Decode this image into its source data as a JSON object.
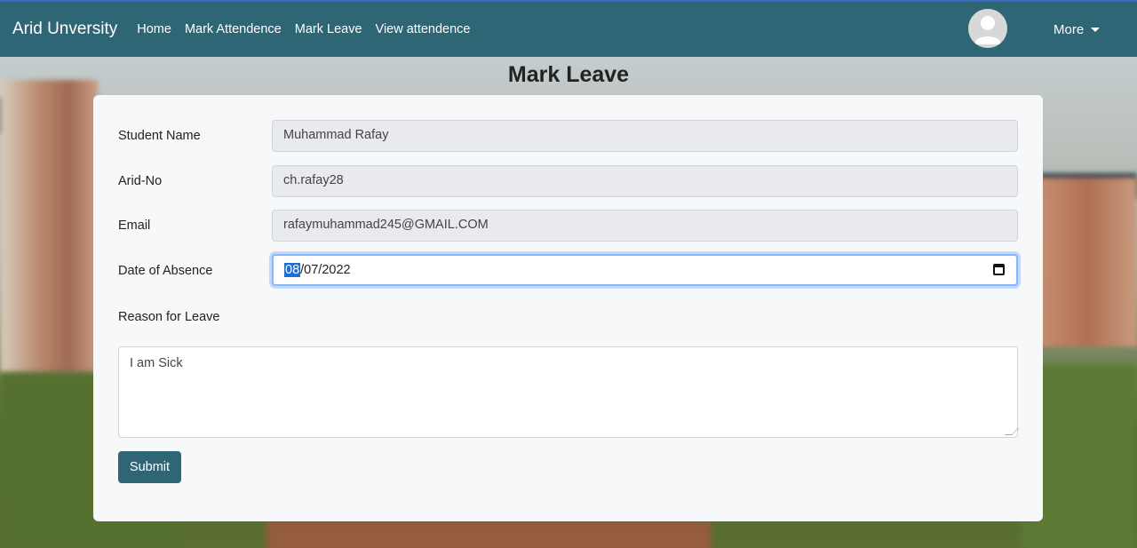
{
  "navbar": {
    "brand": "Arid Unversity",
    "links": [
      "Home",
      "Mark Attendence",
      "Mark Leave",
      "View attendence"
    ],
    "more_label": "More"
  },
  "page": {
    "title": "Mark Leave"
  },
  "form": {
    "student_name": {
      "label": "Student Name",
      "value": "Muhammad Rafay"
    },
    "arid_no": {
      "label": "Arid-No",
      "value": "ch.rafay28"
    },
    "email": {
      "label": "Email",
      "value": "rafaymuhammad245@GMAIL.COM"
    },
    "date": {
      "label": "Date of Absence",
      "month": "08",
      "rest": "/07/2022"
    },
    "reason": {
      "label": "Reason for Leave",
      "value": "I am Sick"
    },
    "submit_label": "Submit"
  },
  "colors": {
    "navbar": "#2e6675",
    "button": "#2e6675",
    "focus_ring": "#86b7fe"
  },
  "icons": {
    "avatar": "user-avatar-icon",
    "more_caret": "chevron-down-icon",
    "date_picker": "calendar-icon"
  }
}
